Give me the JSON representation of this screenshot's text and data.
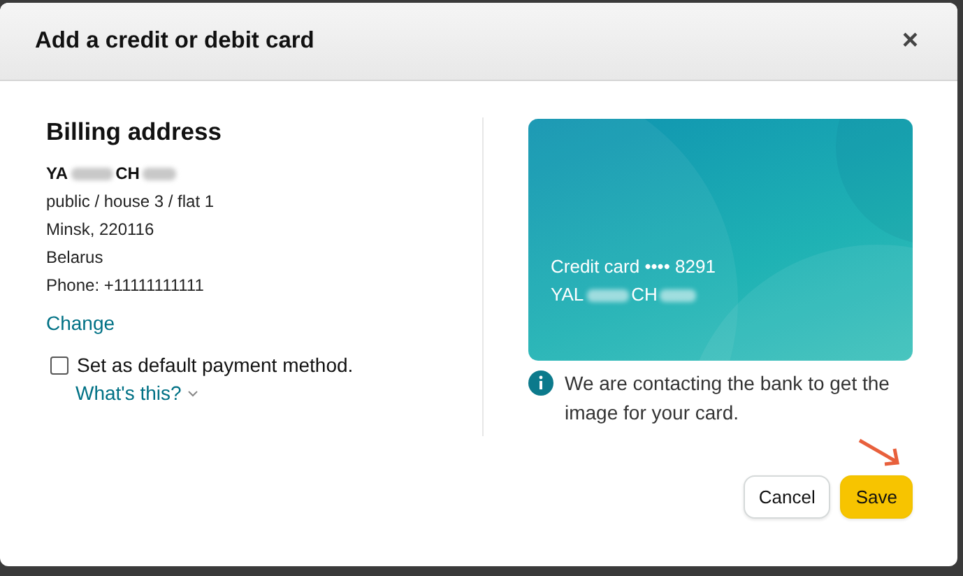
{
  "dialog": {
    "title": "Add a credit or debit card",
    "close": "×"
  },
  "billing": {
    "heading": "Billing address",
    "name_parts": [
      "YA",
      "CH"
    ],
    "lines": [
      "public / house 3 / flat 1",
      "Minsk, 220116",
      "Belarus",
      "Phone: +11111111111"
    ],
    "change_link": "Change"
  },
  "default_option": {
    "label": "Set as default payment method.",
    "checked": false,
    "help_link": "What's this?"
  },
  "card": {
    "label": "Credit card •••• 8291",
    "holder_parts": [
      "YAL",
      "CH"
    ]
  },
  "notice": "We are contacting the bank to get the image for your card.",
  "buttons": [
    {
      "label": "Cancel",
      "kind": "secondary"
    },
    {
      "label": "Save",
      "kind": "primary"
    }
  ]
}
